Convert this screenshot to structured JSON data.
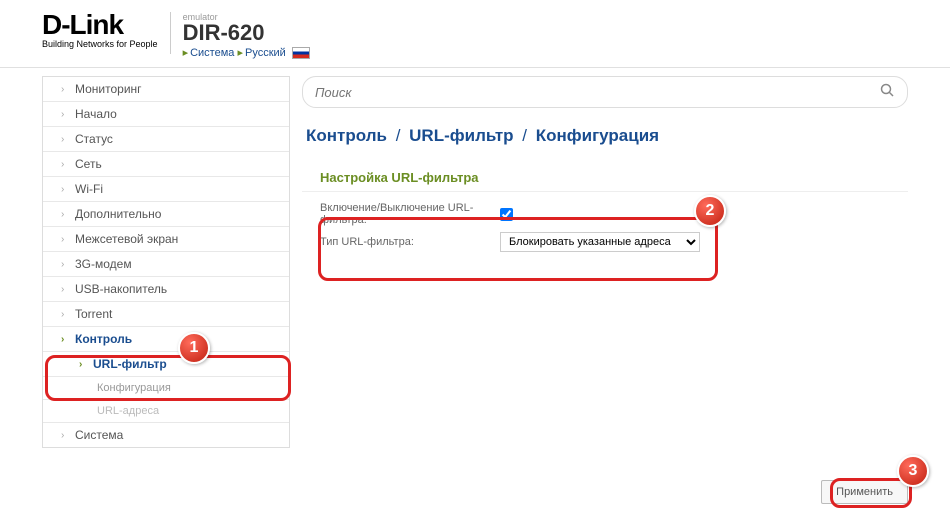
{
  "header": {
    "brand": "D-Link",
    "tagline": "Building Networks for People",
    "emulator_label": "emulator",
    "model": "DIR-620",
    "link_system": "Система",
    "link_lang": "Русский"
  },
  "sidebar": {
    "items": [
      {
        "label": "Мониторинг"
      },
      {
        "label": "Начало"
      },
      {
        "label": "Статус"
      },
      {
        "label": "Сеть"
      },
      {
        "label": "Wi-Fi"
      },
      {
        "label": "Дополнительно"
      },
      {
        "label": "Межсетевой экран"
      },
      {
        "label": "3G-модем"
      },
      {
        "label": "USB-накопитель"
      },
      {
        "label": "Torrent"
      },
      {
        "label": "Контроль",
        "open": true,
        "children": [
          {
            "label": "URL-фильтр",
            "active": true,
            "children": [
              {
                "label": "Конфигурация",
                "active": true
              },
              {
                "label": "URL-адреса"
              }
            ]
          }
        ]
      },
      {
        "label": "Система"
      }
    ]
  },
  "search": {
    "placeholder": "Поиск"
  },
  "breadcrumb": {
    "a": "Контроль",
    "b": "URL-фильтр",
    "c": "Конфигурация"
  },
  "section": {
    "title": "Настройка URL-фильтра"
  },
  "form": {
    "enable_label": "Включение/Выключение URL-фильтра:",
    "enable_checked": true,
    "type_label": "Тип URL-фильтра:",
    "type_value": "Блокировать указанные адреса"
  },
  "buttons": {
    "apply": "Применить"
  },
  "annotations": {
    "b1": "1",
    "b2": "2",
    "b3": "3"
  }
}
